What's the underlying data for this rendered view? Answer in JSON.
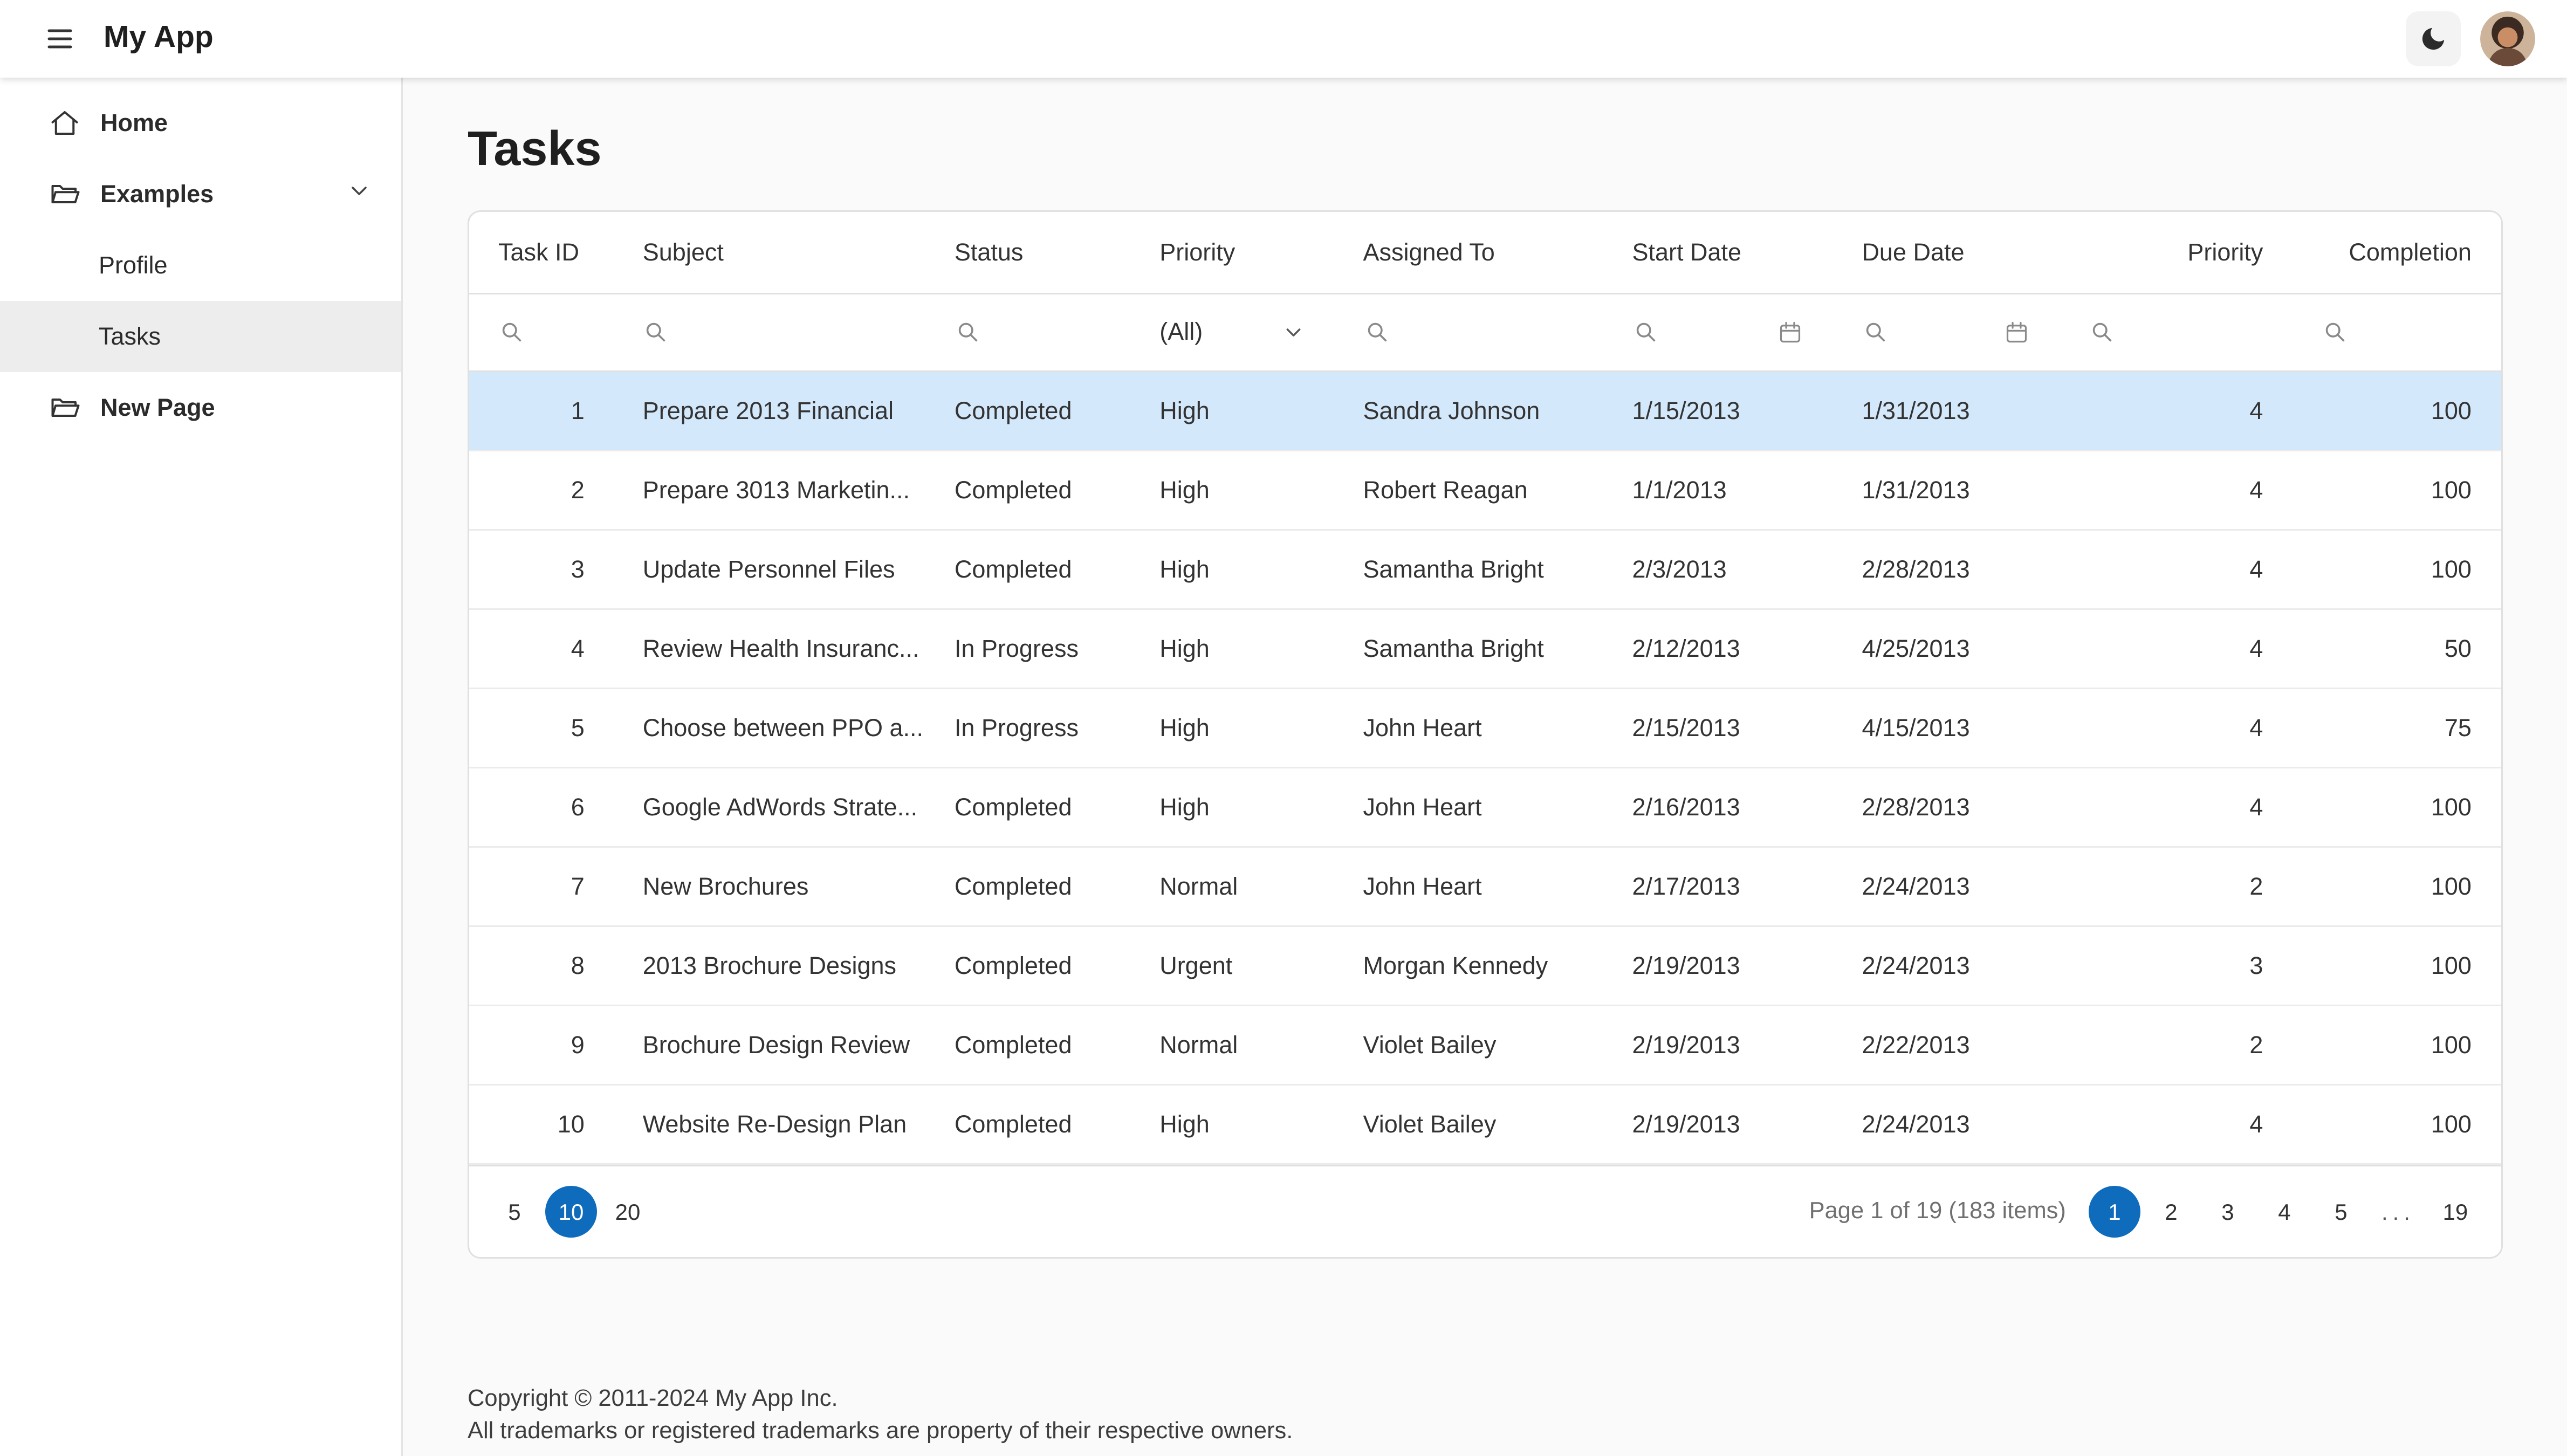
{
  "header": {
    "app_title": "My App"
  },
  "sidebar": {
    "items": [
      {
        "label": "Home"
      },
      {
        "label": "Examples"
      },
      {
        "label": "Profile"
      },
      {
        "label": "Tasks"
      },
      {
        "label": "New Page"
      }
    ]
  },
  "page": {
    "title": "Tasks"
  },
  "grid": {
    "columns": [
      "Task ID",
      "Subject",
      "Status",
      "Priority",
      "Assigned To",
      "Start Date",
      "Due Date",
      "Priority",
      "Completion"
    ],
    "filter": {
      "priority_all": "(All)"
    },
    "rows": [
      {
        "selected": true,
        "id": "1",
        "subject": "Prepare 2013 Financial",
        "status": "Completed",
        "priority": "High",
        "assigned": "Sandra Johnson",
        "start": "1/15/2013",
        "due": "1/31/2013",
        "priority_num": "4",
        "completion": "100"
      },
      {
        "selected": false,
        "id": "2",
        "subject": "Prepare 3013 Marketin...",
        "status": "Completed",
        "priority": "High",
        "assigned": "Robert Reagan",
        "start": "1/1/2013",
        "due": "1/31/2013",
        "priority_num": "4",
        "completion": "100"
      },
      {
        "selected": false,
        "id": "3",
        "subject": "Update Personnel Files",
        "status": "Completed",
        "priority": "High",
        "assigned": "Samantha Bright",
        "start": "2/3/2013",
        "due": "2/28/2013",
        "priority_num": "4",
        "completion": "100"
      },
      {
        "selected": false,
        "id": "4",
        "subject": "Review Health Insuranc...",
        "status": "In Progress",
        "priority": "High",
        "assigned": "Samantha Bright",
        "start": "2/12/2013",
        "due": "4/25/2013",
        "priority_num": "4",
        "completion": "50"
      },
      {
        "selected": false,
        "id": "5",
        "subject": "Choose between PPO a...",
        "status": "In Progress",
        "priority": "High",
        "assigned": "John Heart",
        "start": "2/15/2013",
        "due": "4/15/2013",
        "priority_num": "4",
        "completion": "75"
      },
      {
        "selected": false,
        "id": "6",
        "subject": "Google AdWords Strate...",
        "status": "Completed",
        "priority": "High",
        "assigned": "John Heart",
        "start": "2/16/2013",
        "due": "2/28/2013",
        "priority_num": "4",
        "completion": "100"
      },
      {
        "selected": false,
        "id": "7",
        "subject": "New Brochures",
        "status": "Completed",
        "priority": "Normal",
        "assigned": "John Heart",
        "start": "2/17/2013",
        "due": "2/24/2013",
        "priority_num": "2",
        "completion": "100"
      },
      {
        "selected": false,
        "id": "8",
        "subject": "2013 Brochure Designs",
        "status": "Completed",
        "priority": "Urgent",
        "assigned": "Morgan Kennedy",
        "start": "2/19/2013",
        "due": "2/24/2013",
        "priority_num": "3",
        "completion": "100"
      },
      {
        "selected": false,
        "id": "9",
        "subject": "Brochure Design Review",
        "status": "Completed",
        "priority": "Normal",
        "assigned": "Violet Bailey",
        "start": "2/19/2013",
        "due": "2/22/2013",
        "priority_num": "2",
        "completion": "100"
      },
      {
        "selected": false,
        "id": "10",
        "subject": "Website Re-Design Plan",
        "status": "Completed",
        "priority": "High",
        "assigned": "Violet Bailey",
        "start": "2/19/2013",
        "due": "2/24/2013",
        "priority_num": "4",
        "completion": "100"
      }
    ]
  },
  "pager": {
    "sizes": [
      "5",
      "10",
      "20"
    ],
    "selected_size": "10",
    "info": "Page 1 of 19 (183 items)",
    "pages": [
      "1",
      "2",
      "3",
      "4",
      "5",
      "...",
      "19"
    ],
    "selected_page": "1"
  },
  "footer": {
    "line1": "Copyright © 2011-2024 My App Inc.",
    "line2": "All trademarks or registered trademarks are property of their respective owners."
  },
  "colors": {
    "accent": "#0f6cbd",
    "selected_row": "#d4e8fb",
    "sidebar_selected": "#ededed"
  }
}
